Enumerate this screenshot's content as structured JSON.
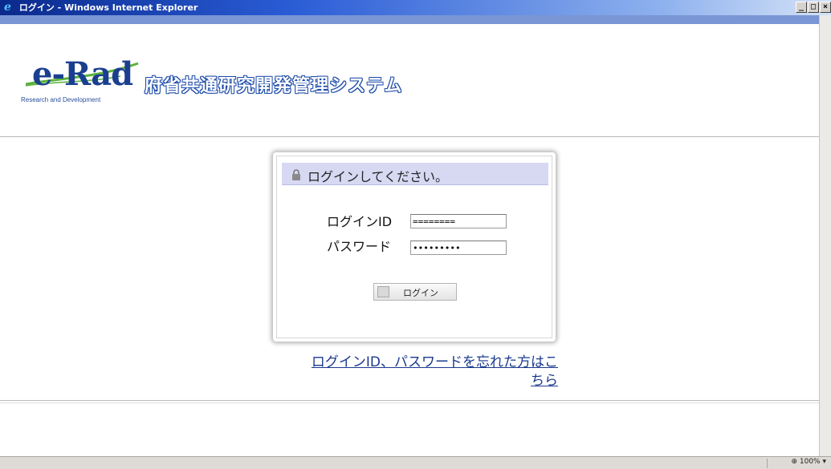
{
  "window": {
    "title": "ログイン - Windows Internet Explorer",
    "minimize": "_",
    "maximize": "□",
    "close": "×"
  },
  "header": {
    "logo_text": "e-Rad",
    "logo_subtitle": "Research and Development",
    "system_name": "府省共通研究開発管理システム"
  },
  "login": {
    "title": "ログインしてください。",
    "id_label": "ログインID",
    "id_value": "========",
    "password_label": "パスワード",
    "password_value": "•••••••••",
    "button_label": "ログイン"
  },
  "forgot_link": {
    "line1": "ログインID、パスワードを忘れた方はこ",
    "line2": "ちら"
  },
  "statusbar": {
    "zoom_level": "100%"
  },
  "colors": {
    "accent": "#1c4aa8",
    "login_header_bg": "#d7d9f3",
    "link": "#1b3a8f"
  }
}
